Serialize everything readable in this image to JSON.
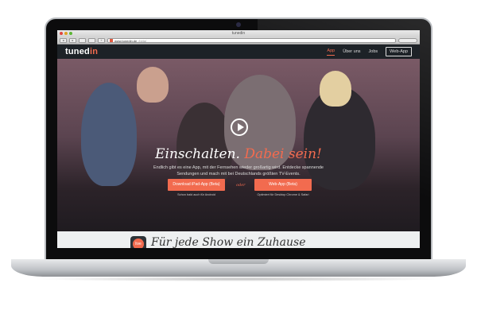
{
  "browser": {
    "title": "tunedin",
    "url": "www.tunedin.de",
    "url_path": "/beta/"
  },
  "nav": {
    "logo_main": "tuned",
    "logo_accent": "in",
    "links": [
      {
        "label": "App",
        "active": true
      },
      {
        "label": "Über uns"
      },
      {
        "label": "Jobs"
      }
    ],
    "webapp_button": "Web-App"
  },
  "hero": {
    "headline_white": "Einschalten.",
    "headline_accent": "Dabei sein!",
    "subtitle": "Endlich gibt es eine App, mit der Fernsehen wieder großartig wird. Entdecke spannende Sendungen und mach mit bei Deutschlands größten TV-Events.",
    "cta_ipad": "Download iPad-App (Beta)",
    "cta_ipad_note": "Schon bald auch für Android",
    "or": "oder",
    "cta_web": "Web-App (Beta)",
    "cta_web_note": "Optimiert für Desktop Chrome & Safari"
  },
  "section": {
    "badge": "live",
    "title": "Für jede Show ein Zuhause"
  },
  "colors": {
    "accent": "#f26b4f",
    "nav_bg": "#1d2227"
  }
}
